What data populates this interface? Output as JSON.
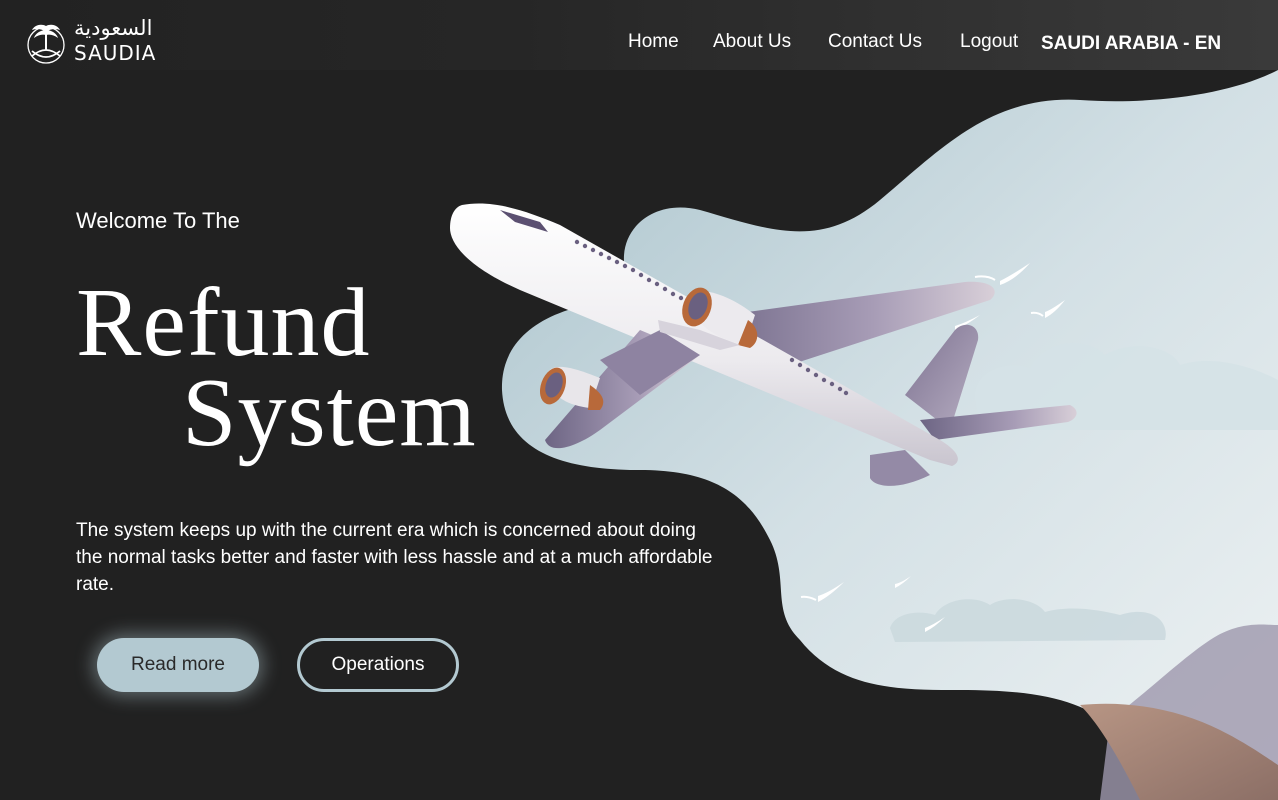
{
  "brand": {
    "arabic_name": "السعودية",
    "latin_name": "SAUDIA"
  },
  "nav": {
    "items": [
      {
        "label": "Home"
      },
      {
        "label": "About Us"
      },
      {
        "label": "Contact Us"
      },
      {
        "label": "Logout"
      }
    ],
    "region_label": "SAUDI ARABIA - EN"
  },
  "hero": {
    "welcome": "Welcome To The",
    "title_line1": "Refund",
    "title_line2": "System",
    "description": "The system keeps up with the current era which is concerned about doing the normal tasks better and faster with less hassle and at a much affordable rate.",
    "primary_button": "Read more",
    "secondary_button": "Operations"
  },
  "colors": {
    "background": "#212121",
    "accent": "#b3c9d1",
    "sky": "#dfe8ec",
    "airplane_purple": "#8a7f9c",
    "engine_orange": "#b8693a"
  },
  "icons": {
    "logo": "palm-swords-emblem",
    "illustration": "airplane-flying-illustration"
  }
}
